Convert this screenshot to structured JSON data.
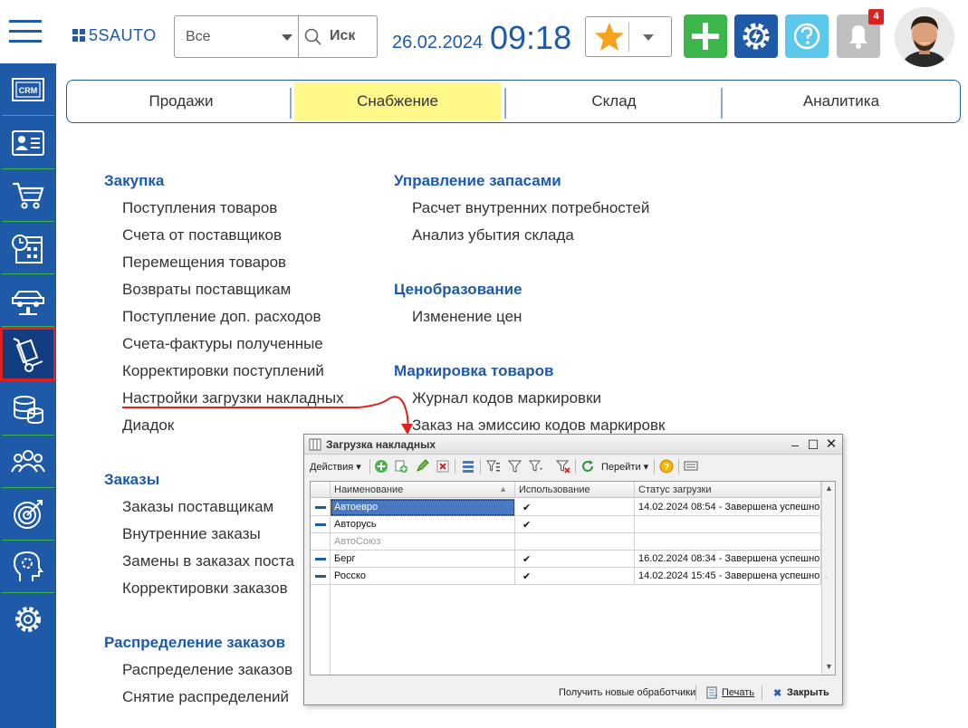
{
  "app": {
    "logo_text": "5SAUTO"
  },
  "header": {
    "filter_value": "Все",
    "search_placeholder": "Иск",
    "date": "26.02.2024",
    "time": "09:18",
    "notifications_count": "4"
  },
  "tabs": [
    {
      "label": "Продажи"
    },
    {
      "label": "Снабжение",
      "active": true
    },
    {
      "label": "Склад"
    },
    {
      "label": "Аналитика"
    }
  ],
  "sidebar": {
    "items": [
      {
        "icon": "crm-icon",
        "label": "CRM"
      },
      {
        "icon": "contact-card-icon"
      },
      {
        "icon": "cart-icon"
      },
      {
        "icon": "calendar-clock-icon"
      },
      {
        "icon": "car-lift-icon"
      },
      {
        "icon": "hand-truck-icon",
        "selected": true
      },
      {
        "icon": "coins-icon"
      },
      {
        "icon": "people-icon"
      },
      {
        "icon": "target-icon"
      },
      {
        "icon": "head-gear-icon"
      },
      {
        "icon": "gear-icon"
      }
    ]
  },
  "menu": {
    "left": {
      "purchase": {
        "title": "Закупка",
        "items": [
          "Поступления товаров",
          "Счета от поставщиков",
          "Перемещения товаров",
          "Возвраты поставщикам",
          "Поступление доп. расходов",
          "Счета-фактуры полученные",
          "Корректировки поступлений",
          "Настройки загрузки накладных",
          "Диадок"
        ]
      },
      "orders": {
        "title": "Заказы",
        "items": [
          "Заказы поставщикам",
          "Внутренние заказы",
          "Замены в заказах поста",
          "Корректировки заказов"
        ]
      },
      "distribution": {
        "title": "Распределение заказов",
        "items": [
          "Распределение заказов",
          "Снятие распределений"
        ]
      }
    },
    "right": {
      "stock": {
        "title": "Управление запасами",
        "items": [
          "Расчет внутренних потребностей",
          "Анализ убытия склада"
        ]
      },
      "pricing": {
        "title": "Ценобразование",
        "items": [
          "Изменение цен"
        ]
      },
      "marking": {
        "title": "Маркировка товаров",
        "items": [
          "Журнал кодов маркировки",
          "Заказ на эмиссию кодов маркировк"
        ]
      }
    }
  },
  "dialog": {
    "title": "Загрузка накладных",
    "toolbar": {
      "actions_label": "Действия",
      "goto_label": "Перейти"
    },
    "columns": [
      "Наименование",
      "Использование",
      "Статус загрузки"
    ],
    "rows": [
      {
        "name": "Автоевро",
        "used": "✔",
        "status": "14.02.2024 08:54 - Завершена успешно",
        "selected": true
      },
      {
        "name": "Авторусь",
        "used": "✔",
        "status": ""
      },
      {
        "name": "АвтоСоюз",
        "used": "",
        "status": "",
        "disabled": true
      },
      {
        "name": "Берг",
        "used": "✔",
        "status": "16.02.2024 08:34 - Завершена успешно"
      },
      {
        "name": "Росско",
        "used": "✔",
        "status": "14.02.2024 15:45 - Завершена успешно"
      }
    ],
    "footer": {
      "get_handlers": "Получить новые обработчики",
      "print": "Печать",
      "close": "Закрыть"
    }
  },
  "colors": {
    "brand": "#1e5aa8",
    "active_tab": "#fff98a",
    "add": "#3cb54a",
    "help": "#5bc8ec",
    "alert": "#e02020"
  }
}
